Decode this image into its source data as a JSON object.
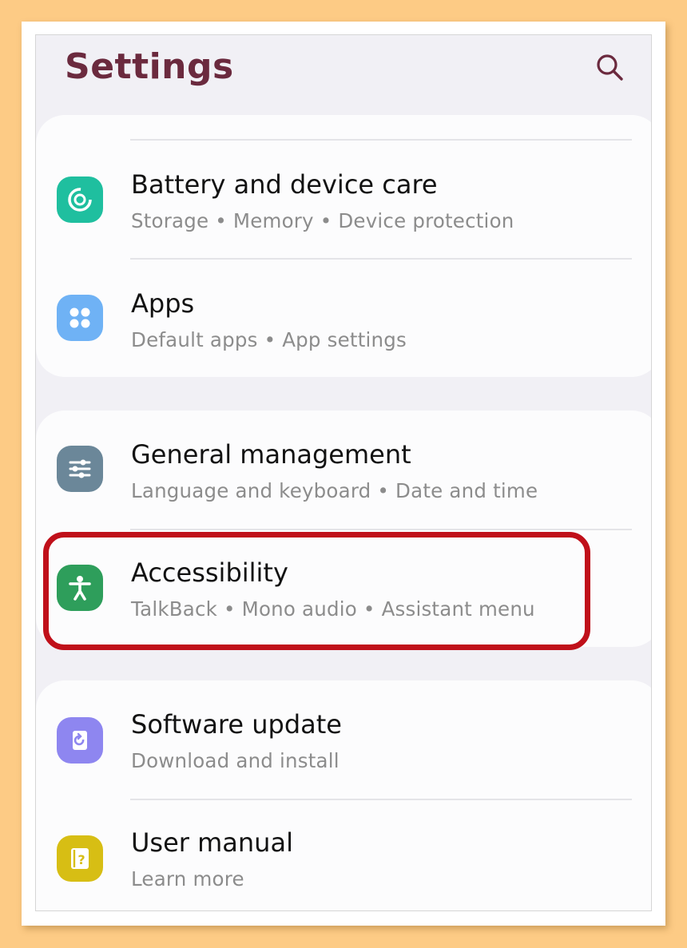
{
  "header": {
    "title": "Settings",
    "search_icon": "search-icon"
  },
  "items": [
    {
      "title": "Battery and device care",
      "subtitle": "Storage  •  Memory  •  Device protection",
      "icon": "battery-care-icon",
      "color": "#1fbf9f"
    },
    {
      "title": "Apps",
      "subtitle": "Default apps  •  App settings",
      "icon": "apps-icon",
      "color": "#6fb2f5"
    },
    {
      "title": "General management",
      "subtitle": "Language and keyboard  •  Date and time",
      "icon": "sliders-icon",
      "color": "#6b8799"
    },
    {
      "title": "Accessibility",
      "subtitle": "TalkBack  •  Mono audio  •  Assistant menu",
      "icon": "accessibility-icon",
      "color": "#2e9e5b"
    },
    {
      "title": "Software update",
      "subtitle": "Download and install",
      "icon": "software-update-icon",
      "color": "#8e86f0"
    },
    {
      "title": "User manual",
      "subtitle": "Learn more",
      "icon": "user-manual-icon",
      "color": "#d7be14"
    }
  ],
  "highlight_color": "#c0101a"
}
